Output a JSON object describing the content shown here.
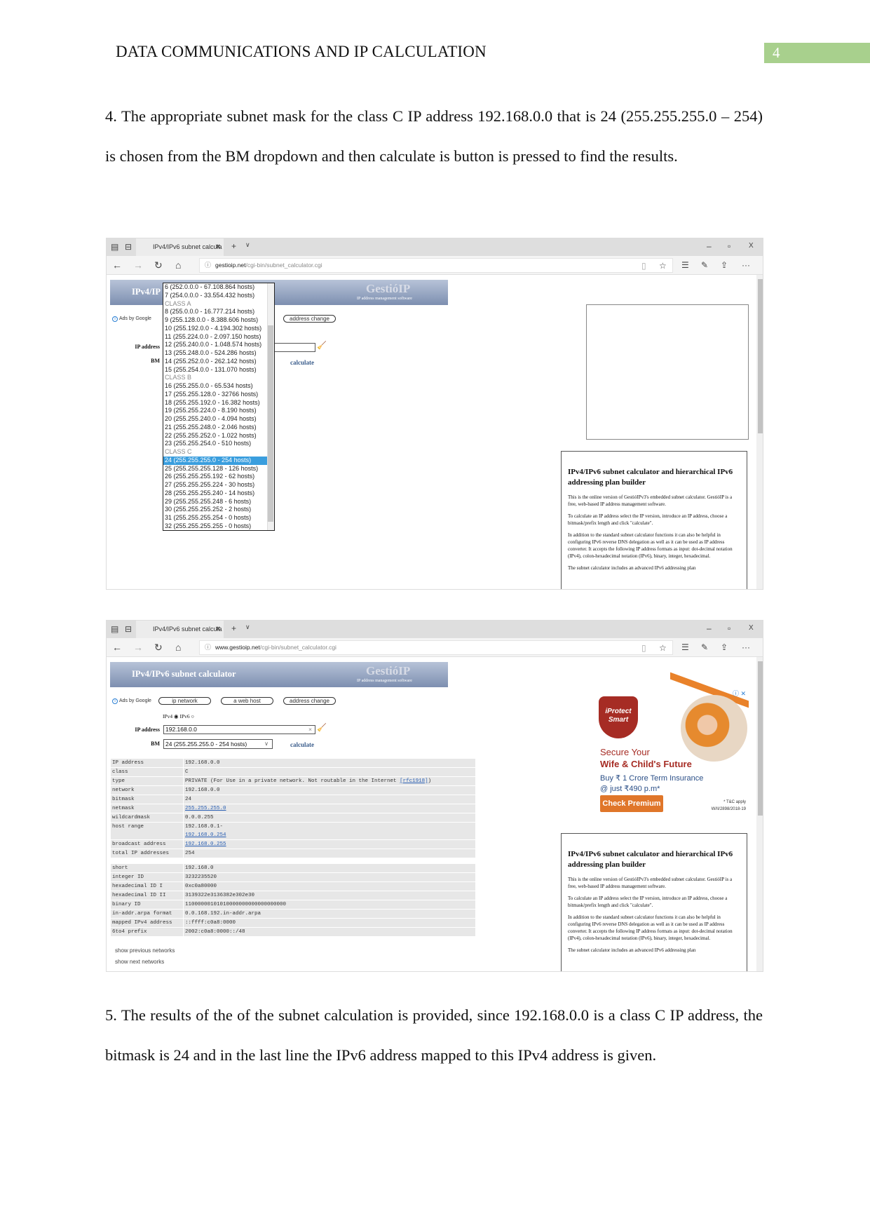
{
  "header": {
    "title": "DATA COMMUNICATIONS AND IP CALCULATION",
    "page_number": "4",
    "page_number_bg": "#a8d08d"
  },
  "paragraphs": [
    "4. The appropriate subnet mask for the class C IP address 192.168.0.0 that is 24 (255.255.255.0 – 254) is chosen from the BM dropdown and then calculate is button is pressed to find the results.",
    "5. The results of the of the subnet calculation is provided, since 192.168.0.0 is a class C IP address, the bitmask is 24 and in the last line the IPv6 address mapped to this IPv4 address is given."
  ],
  "browser": {
    "tab_title": "IPv4/IPv6 subnet calcula",
    "tab_icons": [
      "tabs-aside-icon",
      "back-tab-icon",
      "close-icon",
      "new-tab-icon",
      "chevron-down-icon"
    ],
    "window_controls": {
      "minimize": "–",
      "restore": "▫",
      "close": "X"
    },
    "nav": {
      "back": "←",
      "forward": "→",
      "refresh": "↻",
      "home": "⌂",
      "more": "···"
    },
    "shot1_url": {
      "domain": "gestioip.net",
      "path": "/cgi-bin/subnet_calculator.cgi"
    },
    "shot2_url": {
      "domain": "www.gestioip.net",
      "path": "/cgi-bin/subnet_calculator.cgi"
    }
  },
  "calc": {
    "title": "IPv4/IPv6 subnet calculator",
    "title_truncated": "IPv4/IP",
    "logo": "GestióIP",
    "logo_sub": "IP address management software",
    "ads_label": "Ads by Google",
    "ad_buttons": [
      "ip network",
      "a web host",
      "address change"
    ],
    "ipv4_label": "IPv4",
    "ipv6_label": "IPv6",
    "selected_version": "IPv4",
    "ip_label": "IP address",
    "bm_label": "BM",
    "ip_value": "192.168.0.0",
    "bm_value": "24 (255.255.255.0 - 254 hosts)",
    "calculate": "calculate",
    "clear_x": "×"
  },
  "dropdown": {
    "selected": "24 (255.255.255.0 - 254 hosts)",
    "options": [
      "6 (252.0.0.0 - 67.108.864 hosts)",
      "7 (254.0.0.0 - 33.554.432 hosts)",
      "CLASS A",
      "8 (255.0.0.0 - 16.777.214 hosts)",
      "9 (255.128.0.0 - 8.388.606 hosts)",
      "10 (255.192.0.0 - 4.194.302 hosts)",
      "11 (255.224.0.0 - 2.097.150 hosts)",
      "12 (255.240.0.0 - 1.048.574 hosts)",
      "13 (255.248.0.0 - 524.286 hosts)",
      "14 (255.252.0.0 - 262.142 hosts)",
      "15 (255.254.0.0 - 131.070 hosts)",
      "CLASS B",
      "16 (255.255.0.0 - 65.534 hosts)",
      "17 (255.255.128.0 - 32766 hosts)",
      "18 (255.255.192.0 - 16.382 hosts)",
      "19 (255.255.224.0 - 8.190 hosts)",
      "20 (255.255.240.0 - 4.094 hosts)",
      "21 (255.255.248.0 - 2.046 hosts)",
      "22 (255.255.252.0 - 1.022 hosts)",
      "23 (255.255.254.0 - 510 hosts)",
      "CLASS C",
      "24 (255.255.255.0 - 254 hosts)",
      "25 (255.255.255.128 - 126 hosts)",
      "26 (255.255.255.192 - 62 hosts)",
      "27 (255.255.255.224 - 30 hosts)",
      "28 (255.255.255.240 - 14 hosts)",
      "29 (255.255.255.248 - 6 hosts)",
      "30 (255.255.255.252 - 2 hosts)",
      "31 (255.255.255.254 - 0 hosts)",
      "32 (255.255.255.255 - 0 hosts)"
    ]
  },
  "results": {
    "block1": [
      {
        "k": "IP address",
        "v": "192.168.0.0"
      },
      {
        "k": "class",
        "v": "C"
      },
      {
        "k": "type",
        "v": "PRIVATE (For Use in a private network. Not routable in the Internet ",
        "link": "[rfc1918]",
        "after": ")"
      },
      {
        "k": "network",
        "v": "192.168.0.0"
      },
      {
        "k": "bitmask",
        "v": "24"
      },
      {
        "k": "netmask",
        "v": "",
        "link": "255.255.255.0"
      },
      {
        "k": "wildcardmask",
        "v": "0.0.0.255"
      },
      {
        "k": "host range",
        "v": "192.168.0.1-",
        "link2": "192.168.0.254"
      },
      {
        "k": "broadcast address",
        "v": "",
        "link": "192.168.0.255"
      },
      {
        "k": "total IP addresses",
        "v": "254"
      }
    ],
    "block2": [
      {
        "k": "short",
        "v": "192.168.0"
      },
      {
        "k": "integer ID",
        "v": "3232235520"
      },
      {
        "k": "hexadecimal ID I",
        "v": "0xc0a80000"
      },
      {
        "k": "hexadecimal ID II",
        "v": "3139322e3136382e302e30"
      },
      {
        "k": "binary ID",
        "v": "11000000101010000000000000000000"
      },
      {
        "k": "in-addr.arpa format",
        "v": "0.0.168.192.in-addr.arpa"
      },
      {
        "k": "mapped IPv4 address",
        "v": "::ffff:c0a8:0000"
      },
      {
        "k": "6to4 prefix",
        "v": "2002:c0a8:0000::/48"
      }
    ],
    "show_previous": "show previous networks",
    "show_next": "show next networks"
  },
  "info": {
    "heading": "IPv4/IPv6 subnet calculator and hierarchical IPv6 addressing plan builder",
    "paragraphs": [
      "This is the online version of GestióIPv3's embedded subnet calculator. GestióIP is a free, web-based IP address management software.",
      "To calculate an IP address select the IP version, introduce an IP address, choose a bitmask/prefix length and click \"calculate\".",
      "In addition to the standard subnet calculator functions it can also be helpful in configuring IPv6 reverse DNS delegation as well as it can be used as IP address converter. It accepts the following IP address formats as input: dot-decimal notation (IPv4), colon-hexadecimal notation (IPv6), binary, integer, hexadecimal.",
      "The subnet calculator includes an advanced IPv6 addressing plan"
    ]
  },
  "ad": {
    "brand_line1": "iProtect",
    "brand_line2": "Smart",
    "headline1": "Secure Your",
    "headline2": "Wife & Child's Future",
    "sub1": "Buy ₹ 1 Crore Term Insurance",
    "sub2": "@ just ₹490 p.m*",
    "cta": "Check Premium",
    "tc": "* T&C apply",
    "code": "W/II/2898/2018-19",
    "adchoices": "ⓘ ✕",
    "accent": "#e0762a"
  }
}
